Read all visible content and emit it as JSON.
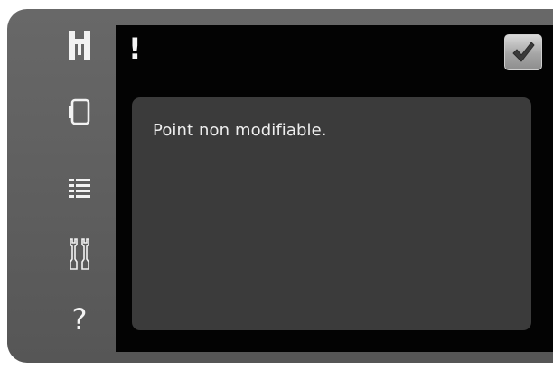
{
  "dialog": {
    "alert_symbol": "!",
    "message": "Point non modifiable.",
    "confirm_icon": "checkmark-icon"
  },
  "sidebar": {
    "items": [
      {
        "icon": "stitch-menu-icon"
      },
      {
        "icon": "screen-icon"
      },
      {
        "icon": "list-icon"
      },
      {
        "icon": "tools-icon"
      },
      {
        "icon": "help-icon",
        "glyph": "?"
      }
    ]
  },
  "colors": {
    "bezel": "#5e5e5e",
    "screen": "#030303",
    "panel": "#3b3b3b",
    "text": "#eeeeee"
  }
}
